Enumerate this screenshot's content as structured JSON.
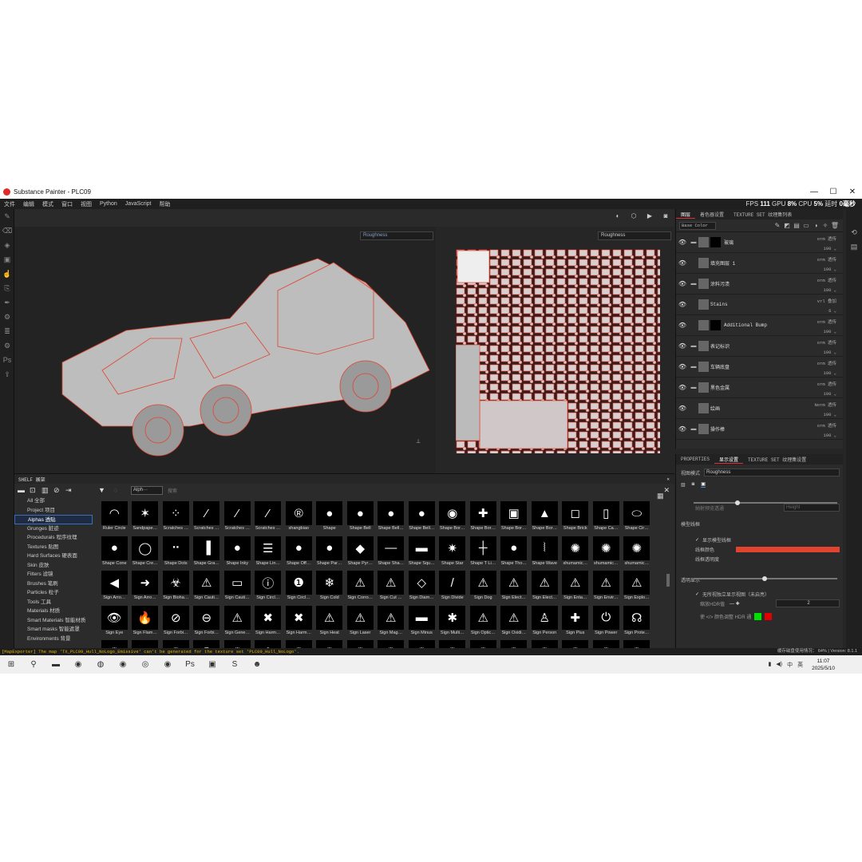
{
  "window": {
    "title": "Substance Painter - PLC09",
    "controls": [
      "—",
      "☐",
      "✕"
    ]
  },
  "menu": {
    "items": [
      "文件",
      "编辑",
      "模式",
      "窗口",
      "视图",
      "Python",
      "JavaScript",
      "帮助"
    ],
    "stats": {
      "fps_label": "FPS",
      "fps": "111",
      "gpu_label": "GPU",
      "gpu": "8%",
      "cpu_label": "CPU",
      "cpu": "5%",
      "delay_label": "延时",
      "delay": "0毫秒"
    }
  },
  "viewport": {
    "left_channel": "Roughness",
    "right_channel": "Roughness",
    "toolbar_icons": [
      "camera-icon",
      "video-icon",
      "cube-icon",
      "dim-icon"
    ]
  },
  "layers_panel": {
    "tabs": [
      "图层",
      "着色器设置",
      "TEXTURE SET 纹理集列表"
    ],
    "channel_select": "Base Color",
    "layers": [
      {
        "name": "玻璃",
        "blend": "orm 透传",
        "opacity": "100",
        "folder": true,
        "has_mask": true
      },
      {
        "name": "填充图层 1",
        "blend": "orm 透传",
        "opacity": "100",
        "folder": false,
        "has_mask": false
      },
      {
        "name": "涂料污渍",
        "blend": "orm 透传",
        "opacity": "100",
        "folder": true,
        "has_mask": false
      },
      {
        "name": "Stains",
        "blend": "vrl 叠加",
        "opacity": "6",
        "folder": false,
        "has_mask": false
      },
      {
        "name": "Additional Bump",
        "blend": "orm 透传",
        "opacity": "100",
        "folder": false,
        "has_mask": true
      },
      {
        "name": "表记标识",
        "blend": "orm 透传",
        "opacity": "100",
        "folder": true,
        "has_mask": false
      },
      {
        "name": "车辆底盘",
        "blend": "orm 透传",
        "opacity": "100",
        "folder": true,
        "has_mask": false
      },
      {
        "name": "黑色金属",
        "blend": "orm 透传",
        "opacity": "100",
        "folder": true,
        "has_mask": false
      },
      {
        "name": "绘画",
        "blend": "Norm 透传",
        "opacity": "100",
        "folder": false,
        "has_mask": false
      },
      {
        "name": "操作棒",
        "blend": "orm 透传",
        "opacity": "100",
        "folder": true,
        "has_mask": false
      }
    ]
  },
  "properties_panel": {
    "tabs": [
      "PROPERTIES",
      "显示设置",
      "TEXTURE SET 纹理集设置"
    ],
    "view_mode_label": "视图模式",
    "view_mode": "Roughness",
    "height_placeholder": "Height",
    "height_label": "納射预览透通",
    "model_wire_title": "模型线框",
    "show_wireframe": "显示模型线框",
    "wire_color_label": "线框颜色",
    "wire_color": "#e0442f",
    "wire_opacity_label": "线框透明度",
    "transparency_title": "透明显示",
    "transparency_option": "无所视独立显示视图（未启亮）",
    "hdr_label": "缩放HDR值",
    "hdr_value": "2",
    "color_adjust_label": "使 </> 颜色调整 HDR 通",
    "swatch_1": "#00e000",
    "swatch_2": "#e00000"
  },
  "shelf": {
    "title": "SHELF 展架",
    "categories": [
      "All 全部",
      "Project 项目",
      "Alphas 透贴",
      "Grunges 脏迹",
      "Procedurals 程序纹理",
      "Textures 贴图",
      "Hard Surfaces 硬表面",
      "Skin 皮肤",
      "Filters 滤镜",
      "Brushes 笔刷",
      "Particles 粒子",
      "Tools 工具",
      "Materials 材质",
      "Smart Materials 智能材质",
      "Smart masks 智能遮罩",
      "Environments 背景"
    ],
    "active_category": "Alphas 透贴",
    "filter_tag": "Alph···",
    "search_placeholder": "搜索",
    "items": [
      [
        "Ruler Circle",
        "Sandpape…",
        "Scratches …",
        "Scratches …",
        "Scratches …",
        "Scratches …",
        "shangbiao",
        "Shape",
        "Shape Bell",
        "Shape Bell…",
        "Shape Bell…",
        "Shape Bor…",
        "Shape Bor…",
        "Shape Bor…",
        "Shape Bor…",
        "Shape Brick",
        "Shape Ca…",
        "Shape Cir…"
      ],
      [
        "Shape Cone",
        "Shape Cre…",
        "Shape Dots",
        "Shape Gra…",
        "Shape Inky",
        "Shape Lin…",
        "Shape Off…",
        "Shape Par…",
        "Shape Pyr…",
        "Shape Sha…",
        "Shape Squ…",
        "Shape Star",
        "Shape T Li…",
        "Shape Tho…",
        "Shape Wave",
        "shumamic…",
        "shumamic…",
        "shumamic…"
      ],
      [
        "Sign Arro…",
        "Sign Arro…",
        "Sign Bioha…",
        "Sign Cauti…",
        "Sign Cauti…",
        "Sign Circl…",
        "Sign Circl…",
        "Sign Cold",
        "Sign Corro…",
        "Sign Cut …",
        "Sign Diam…",
        "Sign Divide",
        "Sign Dog",
        "Sign Elect…",
        "Sign Elect…",
        "Sign Enta…",
        "Sign Envir…",
        "Sign Explo…"
      ],
      [
        "Sign Eye",
        "Sign Flam…",
        "Sign Forbi…",
        "Sign Forbi…",
        "Sign Gene…",
        "Sign Harm…",
        "Sign Harm…",
        "Sign Heat",
        "Sign Laser",
        "Sign Mag…",
        "Sign Minus",
        "Sign Multi…",
        "Sign Optic…",
        "Sign Oxidi…",
        "Sign Person",
        "Sign Plus",
        "Sign Power",
        "Sign Prote…"
      ],
      [
        "",
        "",
        "",
        "",
        "",
        "",
        "",
        "",
        "",
        "",
        "",
        "",
        "",
        "",
        "",
        "",
        "",
        ""
      ]
    ],
    "glyphs": [
      [
        "◠",
        "✶",
        "⁘",
        "⁄",
        "⁄",
        "⁄",
        "®",
        "●",
        "●",
        "●",
        "●",
        "◉",
        "✚",
        "▣",
        "▲",
        "◻",
        "▯",
        "⬭"
      ],
      [
        "●",
        "◯",
        "⠒",
        "▐",
        "●",
        "☰",
        "●",
        "●",
        "◆",
        "—",
        "▬",
        "✷",
        "┼",
        "●",
        "⦚",
        "✺",
        "✺",
        "✺"
      ],
      [
        "◀",
        "➜",
        "☣",
        "⚠",
        "▭",
        "ⓘ",
        "❶",
        "❄",
        "⚠",
        "⚠",
        "◇",
        "/",
        "⚠",
        "⚠",
        "⚠",
        "⚠",
        "⚠",
        "⚠"
      ],
      [
        "👁",
        "🔥",
        "⊘",
        "⊖",
        "⚠",
        "✖",
        "✖",
        "⚠",
        "⚠",
        "⚠",
        "▬",
        "✱",
        "⚠",
        "⚠",
        "♙",
        "✚",
        "⏻",
        "☊"
      ],
      [
        "✺",
        "☺",
        "✺",
        "☢",
        "✺",
        "✿",
        "✺",
        "✺",
        "✺",
        "✺",
        "✺",
        "✺",
        "✺",
        "✺",
        "✺",
        "✺",
        "✺",
        "✺"
      ]
    ]
  },
  "status": {
    "message": "[MapExporter] The map 'TX_PLC09_Hull_NoLogo_Emissive' can't be generated for the texture set 'PLC09_Hull_NoLogo'.",
    "right": "缓存磁盘使用情况：  64%  |  Version: 8.1.1"
  },
  "taskbar": {
    "time": "11:07",
    "date": "2025/5/10",
    "tray": [
      "中",
      "英"
    ]
  }
}
